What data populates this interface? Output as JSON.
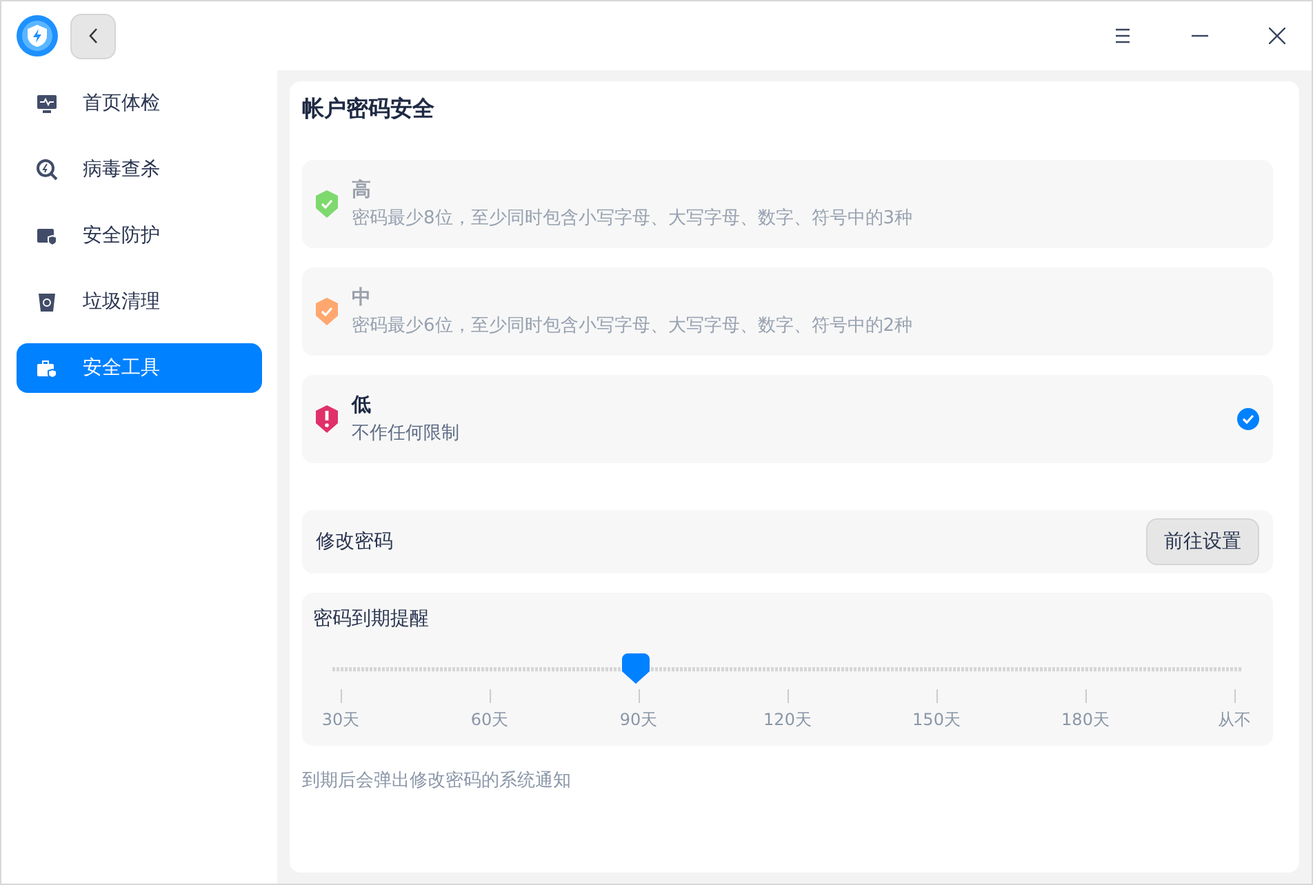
{
  "sidebar": {
    "items": [
      {
        "label": "首页体检",
        "kind": "monitor",
        "selected": false
      },
      {
        "label": "病毒查杀",
        "kind": "scan",
        "selected": false
      },
      {
        "label": "安全防护",
        "kind": "shield",
        "selected": false
      },
      {
        "label": "垃圾清理",
        "kind": "bin",
        "selected": false
      },
      {
        "label": "安全工具",
        "kind": "toolbox",
        "selected": true
      }
    ]
  },
  "title": "帐户密码安全",
  "levels": [
    {
      "name": "高",
      "description": "密码最少8位，至少同时包含小写字母、大写字母、数字、符号中的3种",
      "color": "#7ed96e",
      "kind": "check",
      "selected": false
    },
    {
      "name": "中",
      "description": "密码最少6位，至少同时包含小写字母、大写字母、数字、符号中的2种",
      "color": "#ffa76f",
      "kind": "check",
      "selected": false
    },
    {
      "name": "低",
      "description": "不作任何限制",
      "color": "#e0306a",
      "kind": "alert",
      "selected": true
    }
  ],
  "change_password": {
    "label": "修改密码",
    "button": "前往设置"
  },
  "expiry": {
    "label": "密码到期提醒",
    "level": 0.3333,
    "ticks": [
      "30天",
      "60天",
      "90天",
      "120天",
      "150天",
      "180天",
      "从不"
    ]
  },
  "note": "到期后会弹出修改密码的系统通知"
}
